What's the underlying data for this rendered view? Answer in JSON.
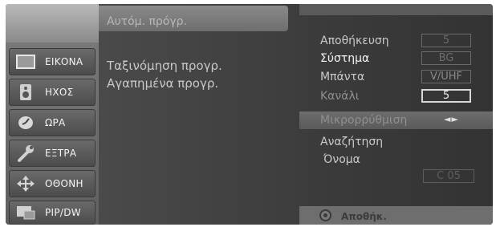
{
  "sidebar": {
    "items": [
      {
        "label": "ΕΙΚΟΝΑ",
        "icon": "picture-icon"
      },
      {
        "label": "ΗΧΟΣ",
        "icon": "speaker-icon"
      },
      {
        "label": "ΩΡΑ",
        "icon": "clock-icon"
      },
      {
        "label": "ΕΞΤΡΑ",
        "icon": "wrench-icon"
      },
      {
        "label": "ΟΘΟΝΗ",
        "icon": "move-arrows-icon"
      },
      {
        "label": "PIP/DW",
        "icon": "pip-icon"
      }
    ]
  },
  "middle": {
    "header": "Αυτόμ. πρόγρ.",
    "items": [
      "Ταξινόμηση προγρ.",
      "Αγαπημένα προγρ."
    ]
  },
  "right": {
    "rows": [
      {
        "label": "Αποθήκευση",
        "value": "5"
      },
      {
        "label": "Σύστημα",
        "value": "BG"
      },
      {
        "label": "Μπάντα",
        "value": "V/UHF"
      },
      {
        "label": "Κανάλι",
        "value": "5"
      }
    ],
    "fine": {
      "label": "Μικρορρύθμιση",
      "arrows": "◄►"
    },
    "search_label": "Αναζήτηση",
    "name_label": "Όνομα",
    "name_value": "C 05",
    "bottom_label": "Αποθήκ."
  }
}
